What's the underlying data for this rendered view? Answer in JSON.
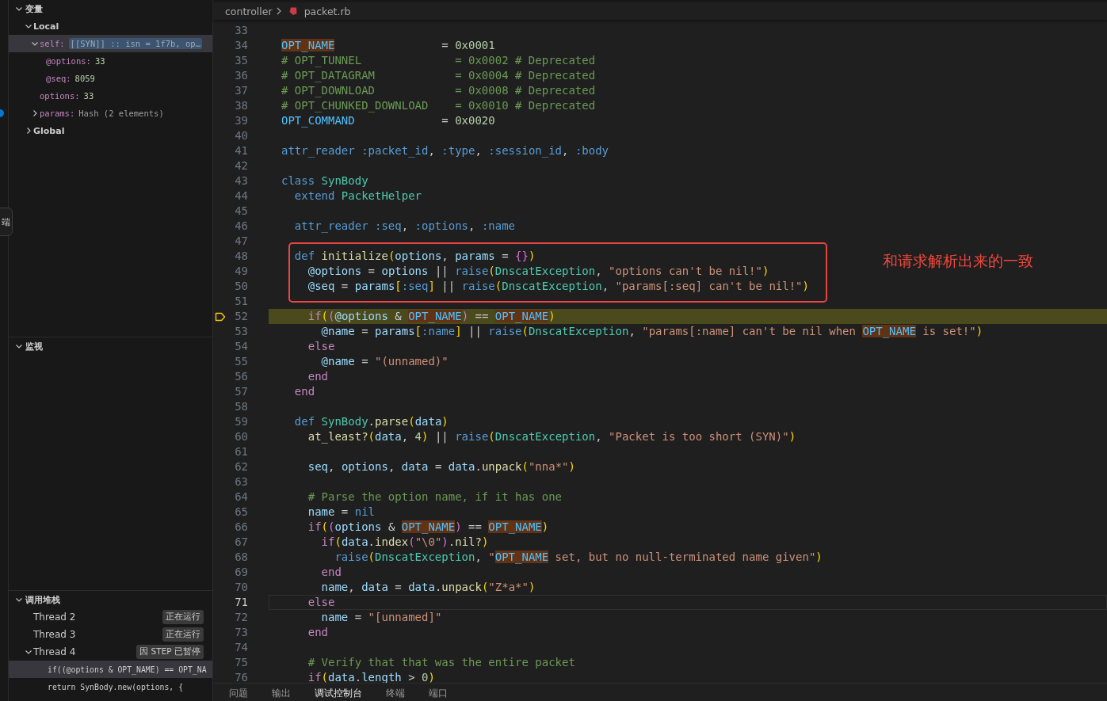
{
  "side_tab": {
    "label": "端"
  },
  "variables": {
    "title": "变量",
    "expanded": true,
    "scopes": [
      {
        "name": "Local",
        "expanded": true,
        "selected": false,
        "children": [
          {
            "name": "self:",
            "value": "[[SYN]] :: isn = 1f7b, op…",
            "kind": "object",
            "expanded": true,
            "selected": true,
            "children": [
              {
                "name": "@options:",
                "value": "33",
                "kind": "number",
                "selected": false
              },
              {
                "name": "@seq:",
                "value": "8059",
                "kind": "number",
                "selected": false
              }
            ]
          },
          {
            "name": "options:",
            "value": "33",
            "kind": "number",
            "selected": false
          },
          {
            "name": "params:",
            "value": "Hash (2 elements)",
            "kind": "object",
            "expanded": false,
            "selected": false
          }
        ]
      },
      {
        "name": "Global",
        "expanded": false,
        "selected": false
      }
    ]
  },
  "watch": {
    "title": "监视",
    "expanded": true
  },
  "call_stack": {
    "title": "调用堆栈",
    "expanded": true,
    "threads": [
      {
        "name": "Thread 2",
        "status": "正在运行"
      },
      {
        "name": "Thread 3",
        "status": "正在运行"
      },
      {
        "name": "Thread 4",
        "status": "因 STEP 已暂停",
        "expanded": true,
        "frames": [
          {
            "text": "if((@options & OPT_NAME) == OPT_NA",
            "selected": true
          },
          {
            "text": "return SynBody.new(options, {",
            "selected": false
          }
        ]
      }
    ]
  },
  "breadcrumb": [
    "controller",
    "packet.rb"
  ],
  "annotation": {
    "text": "和请求解析出来的一致"
  },
  "lines": [
    {
      "num": "33"
    },
    {
      "num": "34",
      "tokens": [
        {
          "kind": "match",
          "text": "OPT_NAME"
        },
        {
          "kind": "plain",
          "text": "                = "
        },
        {
          "kind": "number",
          "text": "0x0001"
        }
      ]
    },
    {
      "num": "35",
      "tokens": [
        {
          "kind": "comment",
          "text": "# OPT_TUNNEL              = 0x0002 # Deprecated"
        }
      ]
    },
    {
      "num": "36",
      "tokens": [
        {
          "kind": "comment",
          "text": "# OPT_DATAGRAM            = 0x0004 # Deprecated"
        }
      ]
    },
    {
      "num": "37",
      "tokens": [
        {
          "kind": "comment",
          "text": "# OPT_DOWNLOAD            = 0x0008 # Deprecated"
        }
      ]
    },
    {
      "num": "38",
      "tokens": [
        {
          "kind": "comment",
          "text": "# OPT_CHUNKED_DOWNLOAD    = 0x0010 # Deprecated"
        }
      ]
    },
    {
      "num": "39",
      "tokens": [
        {
          "kind": "constant",
          "text": "OPT_COMMAND"
        },
        {
          "kind": "plain",
          "text": "             = "
        },
        {
          "kind": "number",
          "text": "0x0020"
        }
      ]
    },
    {
      "num": "40"
    },
    {
      "num": "41",
      "tokens": [
        {
          "kind": "builtin",
          "text": "attr_reader :packet_id"
        },
        {
          "kind": "plain",
          "text": ", "
        },
        {
          "kind": "builtin",
          "text": ":type"
        },
        {
          "kind": "plain",
          "text": ", "
        },
        {
          "kind": "builtin",
          "text": ":session_id"
        },
        {
          "kind": "plain",
          "text": ", "
        },
        {
          "kind": "builtin",
          "text": ":body"
        }
      ]
    },
    {
      "num": "42"
    },
    {
      "num": "43",
      "tokens": [
        {
          "kind": "builtin",
          "text": "class "
        },
        {
          "kind": "class",
          "text": "SynBody"
        }
      ]
    },
    {
      "num": "44",
      "tokens": [
        {
          "kind": "builtin",
          "text": "  extend "
        },
        {
          "kind": "class",
          "text": "PacketHelper"
        }
      ]
    },
    {
      "num": "45"
    },
    {
      "num": "46",
      "tokens": [
        {
          "kind": "builtin",
          "text": "  attr_reader :seq"
        },
        {
          "kind": "plain",
          "text": ", "
        },
        {
          "kind": "builtin",
          "text": ":options"
        },
        {
          "kind": "plain",
          "text": ", "
        },
        {
          "kind": "builtin",
          "text": ":name"
        }
      ]
    },
    {
      "num": "47"
    },
    {
      "num": "48",
      "boxed": true,
      "tokens": [
        {
          "kind": "builtin",
          "text": "  def "
        },
        {
          "kind": "function",
          "text": "initialize"
        },
        {
          "kind": "bracket1",
          "text": "("
        },
        {
          "kind": "variable",
          "text": "options"
        },
        {
          "kind": "plain",
          "text": ", "
        },
        {
          "kind": "variable",
          "text": "params"
        },
        {
          "kind": "plain",
          "text": " = "
        },
        {
          "kind": "bracket2",
          "text": "{}"
        },
        {
          "kind": "bracket1",
          "text": ")"
        }
      ]
    },
    {
      "num": "49",
      "boxed": true,
      "tokens": [
        {
          "kind": "variable",
          "text": "    @options"
        },
        {
          "kind": "plain",
          "text": " = "
        },
        {
          "kind": "variable",
          "text": "options"
        },
        {
          "kind": "plain",
          "text": " || "
        },
        {
          "kind": "builtin",
          "text": "raise"
        },
        {
          "kind": "bracket1",
          "text": "("
        },
        {
          "kind": "class",
          "text": "DnscatException"
        },
        {
          "kind": "plain",
          "text": ", "
        },
        {
          "kind": "string",
          "text": "\"options can't be nil!\""
        },
        {
          "kind": "bracket1",
          "text": ")"
        }
      ]
    },
    {
      "num": "50",
      "boxed": true,
      "tokens": [
        {
          "kind": "variable",
          "text": "    @seq"
        },
        {
          "kind": "plain",
          "text": " = "
        },
        {
          "kind": "variable",
          "text": "params"
        },
        {
          "kind": "bracket1",
          "text": "["
        },
        {
          "kind": "builtin",
          "text": ":seq"
        },
        {
          "kind": "bracket1",
          "text": "]"
        },
        {
          "kind": "plain",
          "text": " || "
        },
        {
          "kind": "builtin",
          "text": "raise"
        },
        {
          "kind": "bracket1",
          "text": "("
        },
        {
          "kind": "class",
          "text": "DnscatException"
        },
        {
          "kind": "plain",
          "text": ", "
        },
        {
          "kind": "string",
          "text": "\"params[:seq] can't be nil!\""
        },
        {
          "kind": "bracket1",
          "text": ")"
        }
      ]
    },
    {
      "num": "51"
    },
    {
      "num": "52",
      "paused": true,
      "tokens": [
        {
          "kind": "keyword",
          "text": "    if"
        },
        {
          "kind": "bracket1",
          "text": "("
        },
        {
          "kind": "bracket2",
          "text": "("
        },
        {
          "kind": "variable",
          "text": "@options"
        },
        {
          "kind": "plain",
          "text": " & "
        },
        {
          "kind": "match",
          "text": "OPT_NAME"
        },
        {
          "kind": "bracket2",
          "text": ")"
        },
        {
          "kind": "plain",
          "text": " == "
        },
        {
          "kind": "match",
          "text": "OPT_NAME"
        },
        {
          "kind": "bracket1",
          "text": ")"
        }
      ]
    },
    {
      "num": "53",
      "tokens": [
        {
          "kind": "variable",
          "text": "      @name"
        },
        {
          "kind": "plain",
          "text": " = "
        },
        {
          "kind": "variable",
          "text": "params"
        },
        {
          "kind": "bracket1",
          "text": "["
        },
        {
          "kind": "builtin",
          "text": ":name"
        },
        {
          "kind": "bracket1",
          "text": "]"
        },
        {
          "kind": "plain",
          "text": " || "
        },
        {
          "kind": "builtin",
          "text": "raise"
        },
        {
          "kind": "bracket1",
          "text": "("
        },
        {
          "kind": "class",
          "text": "DnscatException"
        },
        {
          "kind": "plain",
          "text": ", "
        },
        {
          "kind": "string",
          "text": "\"params[:name] can't be nil when "
        },
        {
          "kind": "match",
          "text": "OPT_NAME"
        },
        {
          "kind": "string",
          "text": " is set!\""
        },
        {
          "kind": "bracket1",
          "text": ")"
        }
      ]
    },
    {
      "num": "54",
      "tokens": [
        {
          "kind": "keyword",
          "text": "    else"
        }
      ]
    },
    {
      "num": "55",
      "tokens": [
        {
          "kind": "variable",
          "text": "      @name"
        },
        {
          "kind": "plain",
          "text": " = "
        },
        {
          "kind": "string",
          "text": "\"(unnamed)\""
        }
      ]
    },
    {
      "num": "56",
      "tokens": [
        {
          "kind": "keyword",
          "text": "    end"
        }
      ]
    },
    {
      "num": "57",
      "tokens": [
        {
          "kind": "keyword",
          "text": "  end"
        }
      ]
    },
    {
      "num": "58"
    },
    {
      "num": "59",
      "tokens": [
        {
          "kind": "builtin",
          "text": "  def "
        },
        {
          "kind": "class",
          "text": "SynBody"
        },
        {
          "kind": "plain",
          "text": "."
        },
        {
          "kind": "function",
          "text": "parse"
        },
        {
          "kind": "bracket1",
          "text": "("
        },
        {
          "kind": "variable",
          "text": "data"
        },
        {
          "kind": "bracket1",
          "text": ")"
        }
      ]
    },
    {
      "num": "60",
      "tokens": [
        {
          "kind": "function",
          "text": "    at_least?"
        },
        {
          "kind": "bracket1",
          "text": "("
        },
        {
          "kind": "variable",
          "text": "data"
        },
        {
          "kind": "plain",
          "text": ", "
        },
        {
          "kind": "number",
          "text": "4"
        },
        {
          "kind": "bracket1",
          "text": ")"
        },
        {
          "kind": "plain",
          "text": " || "
        },
        {
          "kind": "builtin",
          "text": "raise"
        },
        {
          "kind": "bracket1",
          "text": "("
        },
        {
          "kind": "class",
          "text": "DnscatException"
        },
        {
          "kind": "plain",
          "text": ", "
        },
        {
          "kind": "string",
          "text": "\"Packet is too short (SYN)\""
        },
        {
          "kind": "bracket1",
          "text": ")"
        }
      ]
    },
    {
      "num": "61"
    },
    {
      "num": "62",
      "tokens": [
        {
          "kind": "variable",
          "text": "    seq"
        },
        {
          "kind": "plain",
          "text": ", "
        },
        {
          "kind": "variable",
          "text": "options"
        },
        {
          "kind": "plain",
          "text": ", "
        },
        {
          "kind": "variable",
          "text": "data"
        },
        {
          "kind": "plain",
          "text": " = "
        },
        {
          "kind": "variable",
          "text": "data"
        },
        {
          "kind": "plain",
          "text": "."
        },
        {
          "kind": "function",
          "text": "unpack"
        },
        {
          "kind": "bracket1",
          "text": "("
        },
        {
          "kind": "string",
          "text": "\"nna*\""
        },
        {
          "kind": "bracket1",
          "text": ")"
        }
      ]
    },
    {
      "num": "63"
    },
    {
      "num": "64",
      "tokens": [
        {
          "kind": "comment",
          "text": "    # Parse the option name, if it has one"
        }
      ]
    },
    {
      "num": "65",
      "tokens": [
        {
          "kind": "variable",
          "text": "    name"
        },
        {
          "kind": "plain",
          "text": " = "
        },
        {
          "kind": "builtin",
          "text": "nil"
        }
      ]
    },
    {
      "num": "66",
      "tokens": [
        {
          "kind": "keyword",
          "text": "    if"
        },
        {
          "kind": "bracket1",
          "text": "("
        },
        {
          "kind": "bracket2",
          "text": "("
        },
        {
          "kind": "variable",
          "text": "options"
        },
        {
          "kind": "plain",
          "text": " & "
        },
        {
          "kind": "match",
          "text": "OPT_NAME"
        },
        {
          "kind": "bracket2",
          "text": ")"
        },
        {
          "kind": "plain",
          "text": " == "
        },
        {
          "kind": "match",
          "text": "OPT_NAME"
        },
        {
          "kind": "bracket1",
          "text": ")"
        }
      ]
    },
    {
      "num": "67",
      "tokens": [
        {
          "kind": "keyword",
          "text": "      if"
        },
        {
          "kind": "bracket1",
          "text": "("
        },
        {
          "kind": "variable",
          "text": "data"
        },
        {
          "kind": "plain",
          "text": "."
        },
        {
          "kind": "function",
          "text": "index"
        },
        {
          "kind": "bracket2",
          "text": "("
        },
        {
          "kind": "string",
          "text": "\"\\0\""
        },
        {
          "kind": "bracket2",
          "text": ")"
        },
        {
          "kind": "plain",
          "text": "."
        },
        {
          "kind": "function",
          "text": "nil?"
        },
        {
          "kind": "bracket1",
          "text": ")"
        }
      ]
    },
    {
      "num": "68",
      "tokens": [
        {
          "kind": "builtin",
          "text": "        raise"
        },
        {
          "kind": "bracket1",
          "text": "("
        },
        {
          "kind": "class",
          "text": "DnscatException"
        },
        {
          "kind": "plain",
          "text": ", "
        },
        {
          "kind": "string",
          "text": "\""
        },
        {
          "kind": "match",
          "text": "OPT_NAME"
        },
        {
          "kind": "string",
          "text": " set, but no null-terminated name given\""
        },
        {
          "kind": "bracket1",
          "text": ")"
        }
      ]
    },
    {
      "num": "69",
      "tokens": [
        {
          "kind": "keyword",
          "text": "      end"
        }
      ]
    },
    {
      "num": "70",
      "tokens": [
        {
          "kind": "variable",
          "text": "      name"
        },
        {
          "kind": "plain",
          "text": ", "
        },
        {
          "kind": "variable",
          "text": "data"
        },
        {
          "kind": "plain",
          "text": " = "
        },
        {
          "kind": "variable",
          "text": "data"
        },
        {
          "kind": "plain",
          "text": "."
        },
        {
          "kind": "function",
          "text": "unpack"
        },
        {
          "kind": "bracket1",
          "text": "("
        },
        {
          "kind": "string",
          "text": "\"Z*a*\""
        },
        {
          "kind": "bracket1",
          "text": ")"
        }
      ]
    },
    {
      "num": "71",
      "current": true,
      "tokens": [
        {
          "kind": "keyword",
          "text": "    else"
        }
      ]
    },
    {
      "num": "72",
      "tokens": [
        {
          "kind": "variable",
          "text": "      name"
        },
        {
          "kind": "plain",
          "text": " = "
        },
        {
          "kind": "string",
          "text": "\"[unnamed]\""
        }
      ]
    },
    {
      "num": "73",
      "tokens": [
        {
          "kind": "keyword",
          "text": "    end"
        }
      ]
    },
    {
      "num": "74"
    },
    {
      "num": "75",
      "tokens": [
        {
          "kind": "comment",
          "text": "    # Verify that that was the entire packet"
        }
      ]
    },
    {
      "num": "76",
      "tokens": [
        {
          "kind": "keyword",
          "text": "    if"
        },
        {
          "kind": "bracket1",
          "text": "("
        },
        {
          "kind": "variable",
          "text": "data"
        },
        {
          "kind": "plain",
          "text": "."
        },
        {
          "kind": "variable",
          "text": "length"
        },
        {
          "kind": "plain",
          "text": " > "
        },
        {
          "kind": "number",
          "text": "0"
        },
        {
          "kind": "bracket1",
          "text": ")"
        }
      ]
    }
  ],
  "panel_tabs": [
    {
      "label": "问题",
      "selected": false
    },
    {
      "label": "输出",
      "selected": false
    },
    {
      "label": "调试控制台",
      "selected": true
    },
    {
      "label": "终端",
      "selected": false
    },
    {
      "label": "端口",
      "selected": false
    }
  ]
}
